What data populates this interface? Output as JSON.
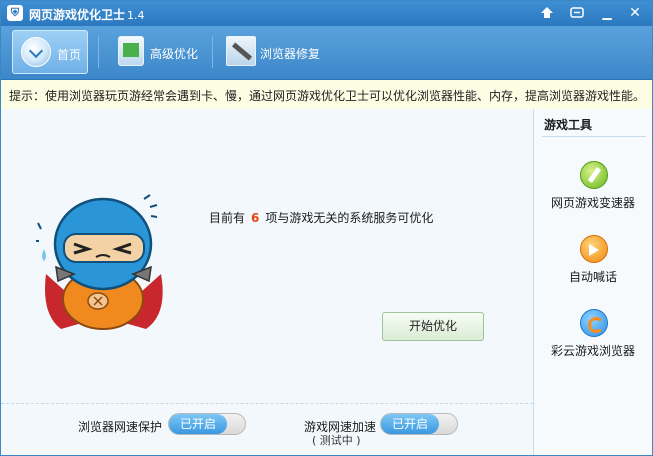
{
  "window": {
    "title": "网页游戏优化卫士",
    "version": "1.4",
    "controls": {
      "minimize": "▁",
      "close": "✕"
    }
  },
  "toolbar": {
    "items": [
      {
        "label": "首页",
        "icon": "home-icon",
        "active": true
      },
      {
        "label": "高级优化",
        "icon": "advanced-optimize-icon",
        "active": false
      },
      {
        "label": "浏览器修复",
        "icon": "browser-repair-icon",
        "active": false
      }
    ]
  },
  "tip": {
    "text": "提示：使用浏览器玩页游经常会遇到卡、慢，通过网页游戏优化卫士可以优化浏览器性能、内存，提高浏览器游戏性能。"
  },
  "main": {
    "message_prefix": "目前有",
    "count": "6",
    "message_suffix": "项与游戏无关的系统服务可优化",
    "start_button": "开始优化"
  },
  "bottom": {
    "browser_protect_label": "浏览器网速保护",
    "browser_protect_state": "已开启",
    "game_speed_label": "游戏网速加速",
    "game_speed_state": "已开启",
    "testing_text": "( 测试中 )"
  },
  "sidebar": {
    "title": "游戏工具",
    "items": [
      {
        "label": "网页游戏变速器",
        "icon": "speed-changer-icon"
      },
      {
        "label": "自动喊话",
        "icon": "auto-shout-icon"
      },
      {
        "label": "彩云游戏浏览器",
        "icon": "caiyun-browser-icon"
      }
    ]
  },
  "colors": {
    "accent": "#2b78bf",
    "count_highlight": "#e5470f",
    "tip_background": "#fcfde3",
    "toggle_on": "#3a98e0"
  }
}
